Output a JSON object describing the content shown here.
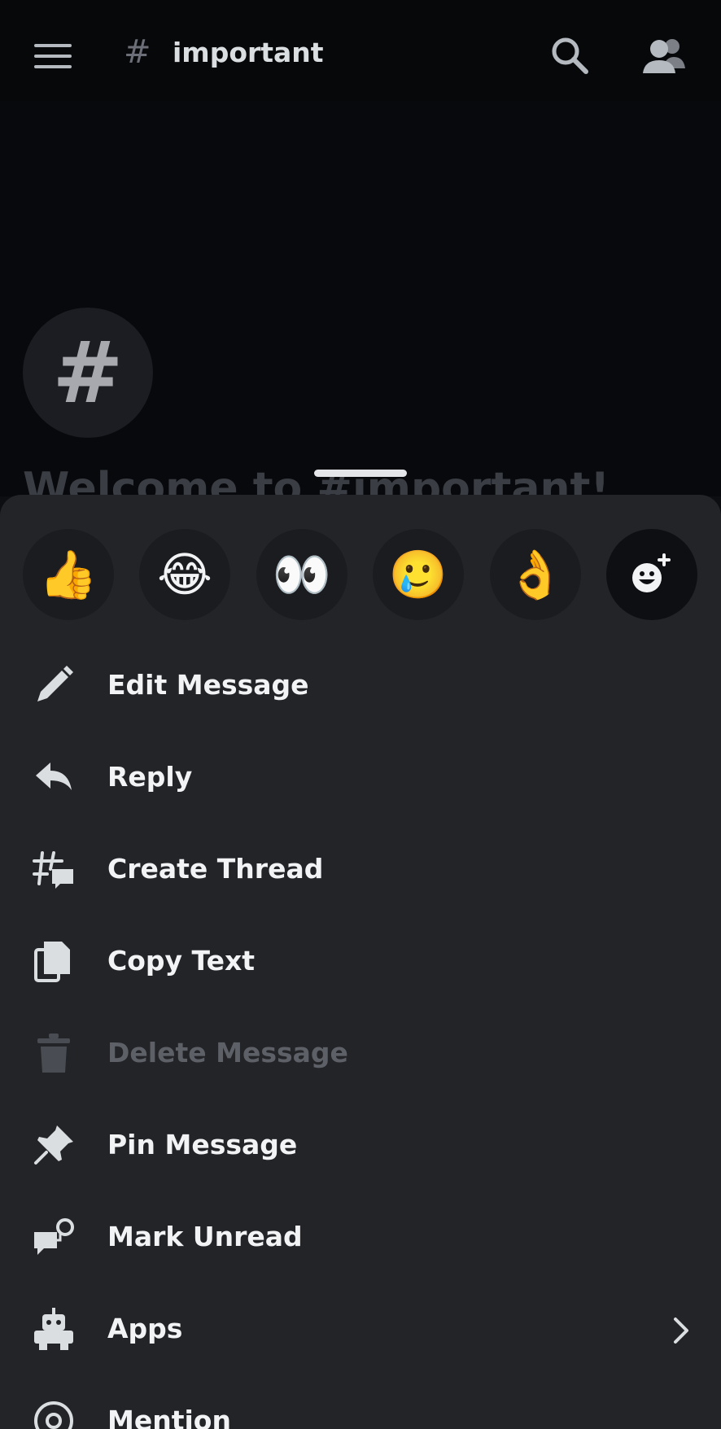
{
  "header": {
    "channel_prefix": "#",
    "channel_name": "important"
  },
  "channel_intro": {
    "avatar_symbol": "#",
    "welcome_text": "Welcome to #important!"
  },
  "reactions": [
    {
      "name": "thumbs-up",
      "emoji": "👍"
    },
    {
      "name": "joy",
      "emoji": "😂"
    },
    {
      "name": "eyes",
      "emoji": "👀"
    },
    {
      "name": "holding-back-tears",
      "emoji": "🥲"
    },
    {
      "name": "ok-hand",
      "emoji": "👌"
    }
  ],
  "menu": {
    "items": [
      {
        "label": "Edit Message",
        "icon": "pencil-icon",
        "disabled": false
      },
      {
        "label": "Reply",
        "icon": "reply-icon",
        "disabled": false
      },
      {
        "label": "Create Thread",
        "icon": "thread-icon",
        "disabled": false
      },
      {
        "label": "Copy Text",
        "icon": "copy-icon",
        "disabled": false
      },
      {
        "label": "Delete Message",
        "icon": "trash-icon",
        "disabled": true
      },
      {
        "label": "Pin Message",
        "icon": "pin-icon",
        "disabled": false
      },
      {
        "label": "Mark Unread",
        "icon": "mark-unread-icon",
        "disabled": false
      },
      {
        "label": "Apps",
        "icon": "robot-icon",
        "disabled": false
      },
      {
        "label": "Mention",
        "icon": "at-icon",
        "disabled": false
      }
    ]
  },
  "colors": {
    "sheet_background": "#232428",
    "text_primary": "#f2f3f5",
    "text_disabled": "#5e6068",
    "icon": "#dbdee1"
  }
}
